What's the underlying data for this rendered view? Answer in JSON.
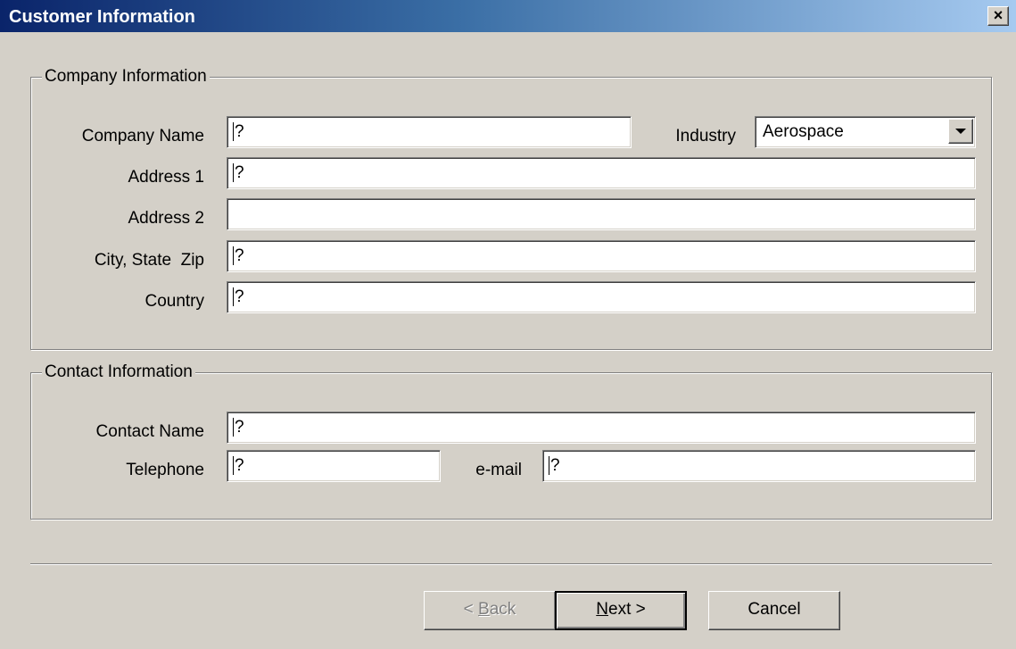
{
  "window": {
    "title": "Customer Information",
    "close_glyph": "×"
  },
  "company": {
    "legend": "Company Information",
    "company_name": {
      "label": "Company Name",
      "value": "?"
    },
    "industry": {
      "label": "Industry",
      "value": "Aerospace"
    },
    "address1": {
      "label": "Address 1",
      "value": "?"
    },
    "address2": {
      "label": "Address 2",
      "value": ""
    },
    "city": {
      "label": "City, State  Zip",
      "value": "?"
    },
    "country": {
      "label": "Country",
      "value": "?"
    }
  },
  "contact": {
    "legend": "Contact Information",
    "contact_name": {
      "label": "Contact Name",
      "value": "?"
    },
    "telephone": {
      "label": "Telephone",
      "value": "?"
    },
    "email": {
      "label": "e-mail",
      "value": "?"
    }
  },
  "buttons": {
    "back": {
      "prefix": "< ",
      "mnemonic": "B",
      "rest": "ack",
      "enabled": false
    },
    "next": {
      "mnemonic": "N",
      "rest": "ext >"
    },
    "cancel": {
      "label": "Cancel"
    }
  },
  "icons": {
    "close": "close-icon",
    "dropdown": "chevron-down-icon"
  }
}
